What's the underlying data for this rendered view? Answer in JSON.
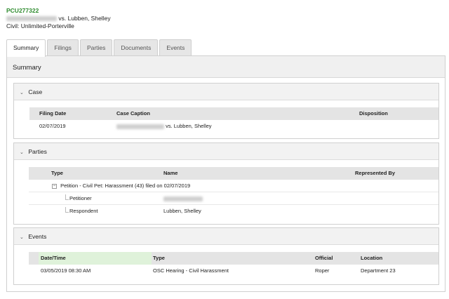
{
  "case": {
    "number": "PCU277322",
    "title_suffix": "vs. Lubben, Shelley",
    "type": "Civil: Unlimited-Porterville"
  },
  "tabs": [
    "Summary",
    "Filings",
    "Parties",
    "Documents",
    "Events"
  ],
  "panel_title": "Summary",
  "case_section": {
    "title": "Case",
    "columns": [
      "Filing Date",
      "Case Caption",
      "Disposition"
    ],
    "row": {
      "filing_date": "02/07/2019",
      "caption_suffix": "vs. Lubben, Shelley",
      "disposition": ""
    }
  },
  "parties_section": {
    "title": "Parties",
    "columns": [
      "Type",
      "Name",
      "Represented By"
    ],
    "group_label": "Petition - Civil Pet: Harassment (43) filed on 02/07/2019",
    "rows": [
      {
        "type": "Petitioner",
        "name": ""
      },
      {
        "type": "Respondent",
        "name": "Lubben, Shelley"
      }
    ]
  },
  "events_section": {
    "title": "Events",
    "columns": [
      "Date/Time",
      "Type",
      "Official",
      "Location"
    ],
    "rows": [
      {
        "datetime": "03/05/2019 08:30 AM",
        "type": "OSC Hearing - Civil Harassment",
        "official": "Roper",
        "location": "Department 23"
      }
    ]
  },
  "icons": {
    "collapse": "chevron-down-icon",
    "tree_toggle": "minus-box-icon"
  },
  "colors": {
    "case_number": "#2e8b2e",
    "sorted_column": "#dff2da",
    "grid_header": "#e4e4e4"
  }
}
